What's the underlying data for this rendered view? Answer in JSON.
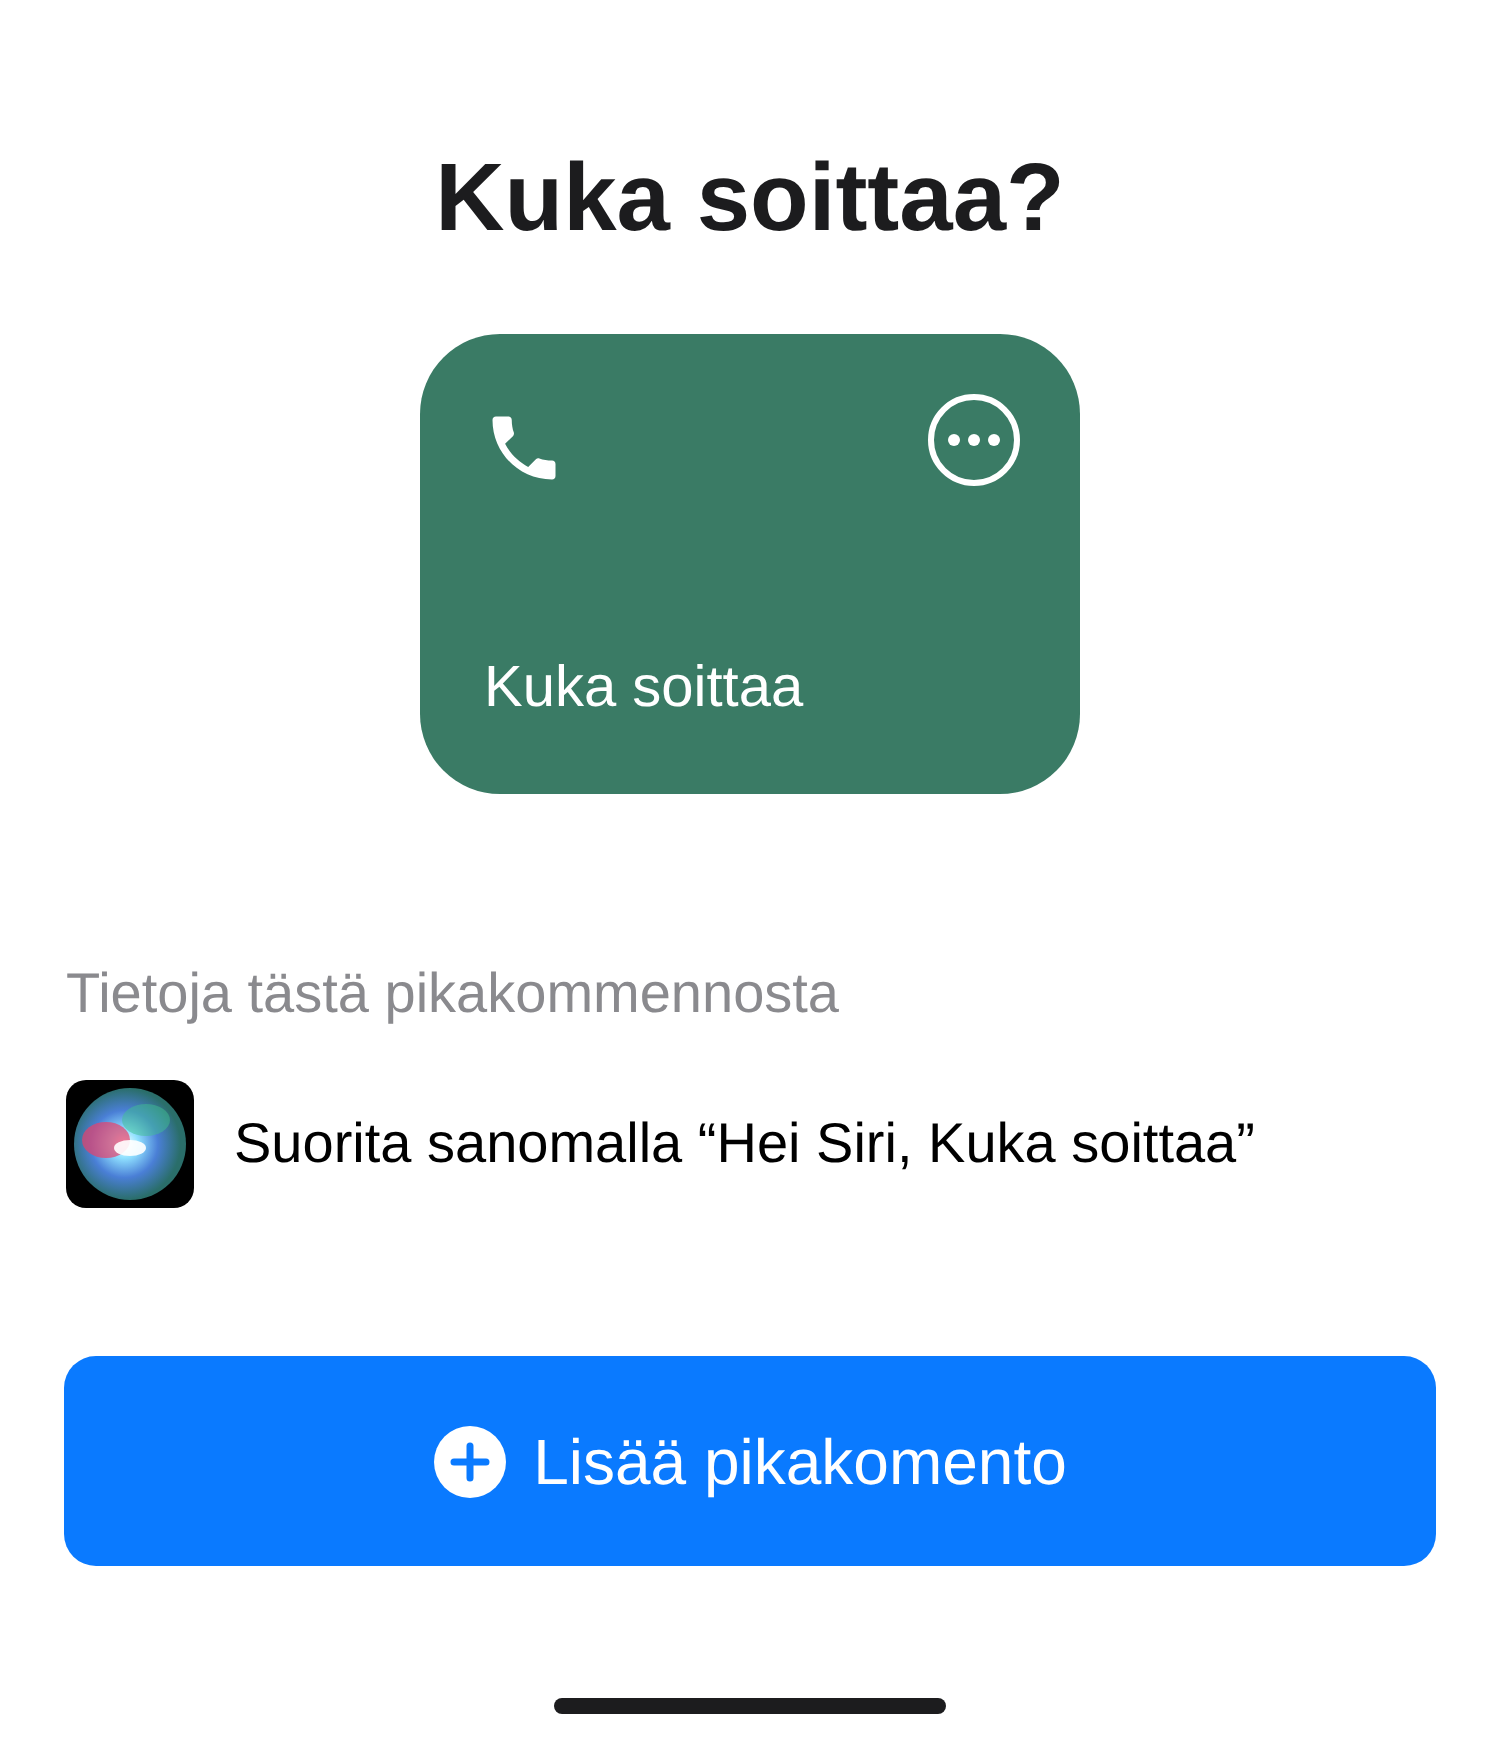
{
  "title": "Kuka soittaa?",
  "shortcut_card": {
    "name": "Kuka soittaa"
  },
  "section_label": "Tietoja tästä pikakommennosta",
  "siri_row": {
    "text": "Suorita sanomalla “Hei Siri, Kuka soittaa”"
  },
  "add_button": {
    "label": "Lisää pikakomento"
  }
}
